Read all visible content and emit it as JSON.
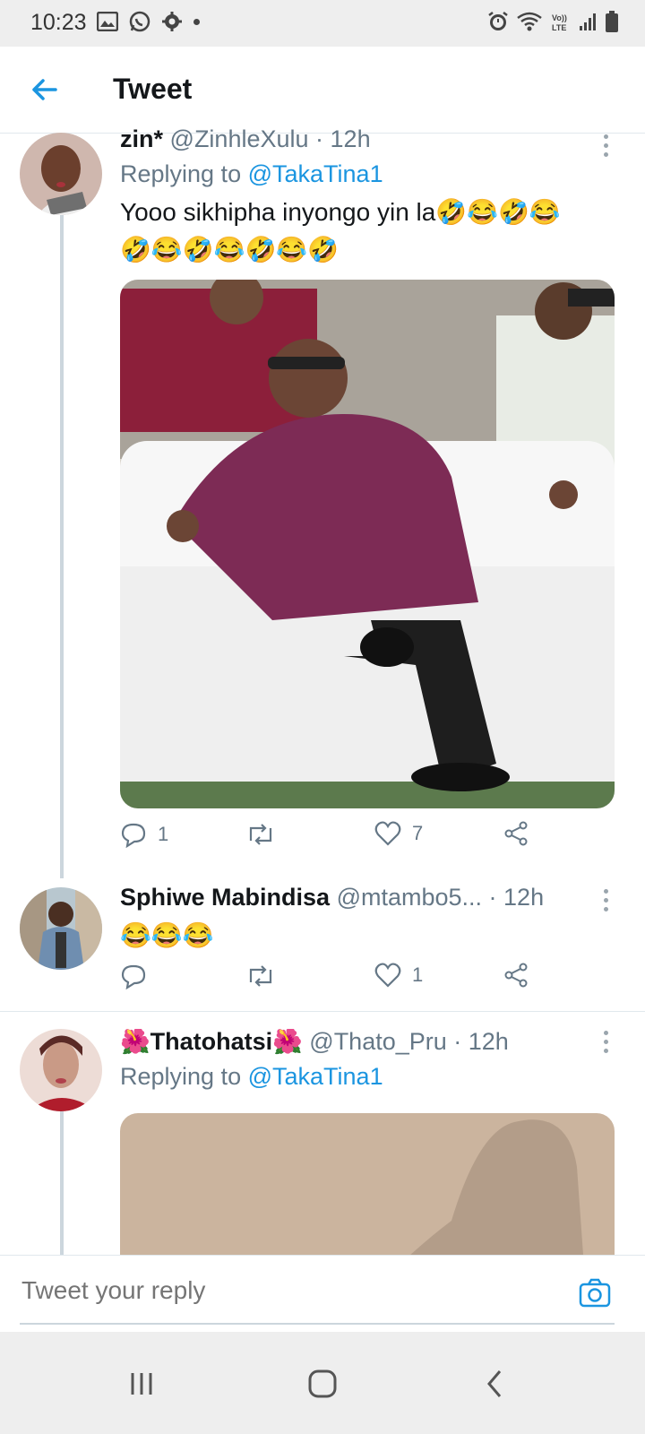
{
  "status_bar": {
    "time": "10:23",
    "left_icons": [
      "gallery-icon",
      "whatsapp-icon",
      "settings-icon"
    ],
    "right_icons": [
      "alarm-icon",
      "wifi-icon",
      "volte-icon",
      "signal-icon",
      "battery-icon"
    ]
  },
  "header": {
    "title": "Tweet"
  },
  "colors": {
    "accent": "#1b95e0",
    "muted": "#657786",
    "text": "#14171a"
  },
  "tweets": [
    {
      "name": "zin*",
      "handle": "@ZinhleXulu",
      "time": "· 12h",
      "replying_prefix": "Replying to",
      "replying_to": "@TakaTina1",
      "text_line1": "Yooo sikhipha inyongo yin la🤣😂🤣😂",
      "text_line2": "🤣😂🤣😂🤣😂🤣",
      "actions": {
        "reply_count": "1",
        "retweet_count": "",
        "like_count": "7"
      }
    },
    {
      "name": "Sphiwe Mabindisa",
      "handle": "@mtambo5...",
      "time": "· 12h",
      "text_line1": "😂😂😂",
      "actions": {
        "reply_count": "",
        "retweet_count": "",
        "like_count": "1"
      }
    },
    {
      "name_prefix": "🌺",
      "name": "Thatohatsi",
      "name_suffix": "🌺",
      "handle": "@Thato_Pru",
      "time": "· 12h",
      "replying_prefix": "Replying to",
      "replying_to": "@TakaTina1"
    }
  ],
  "reply_bar": {
    "placeholder": "Tweet your reply"
  }
}
